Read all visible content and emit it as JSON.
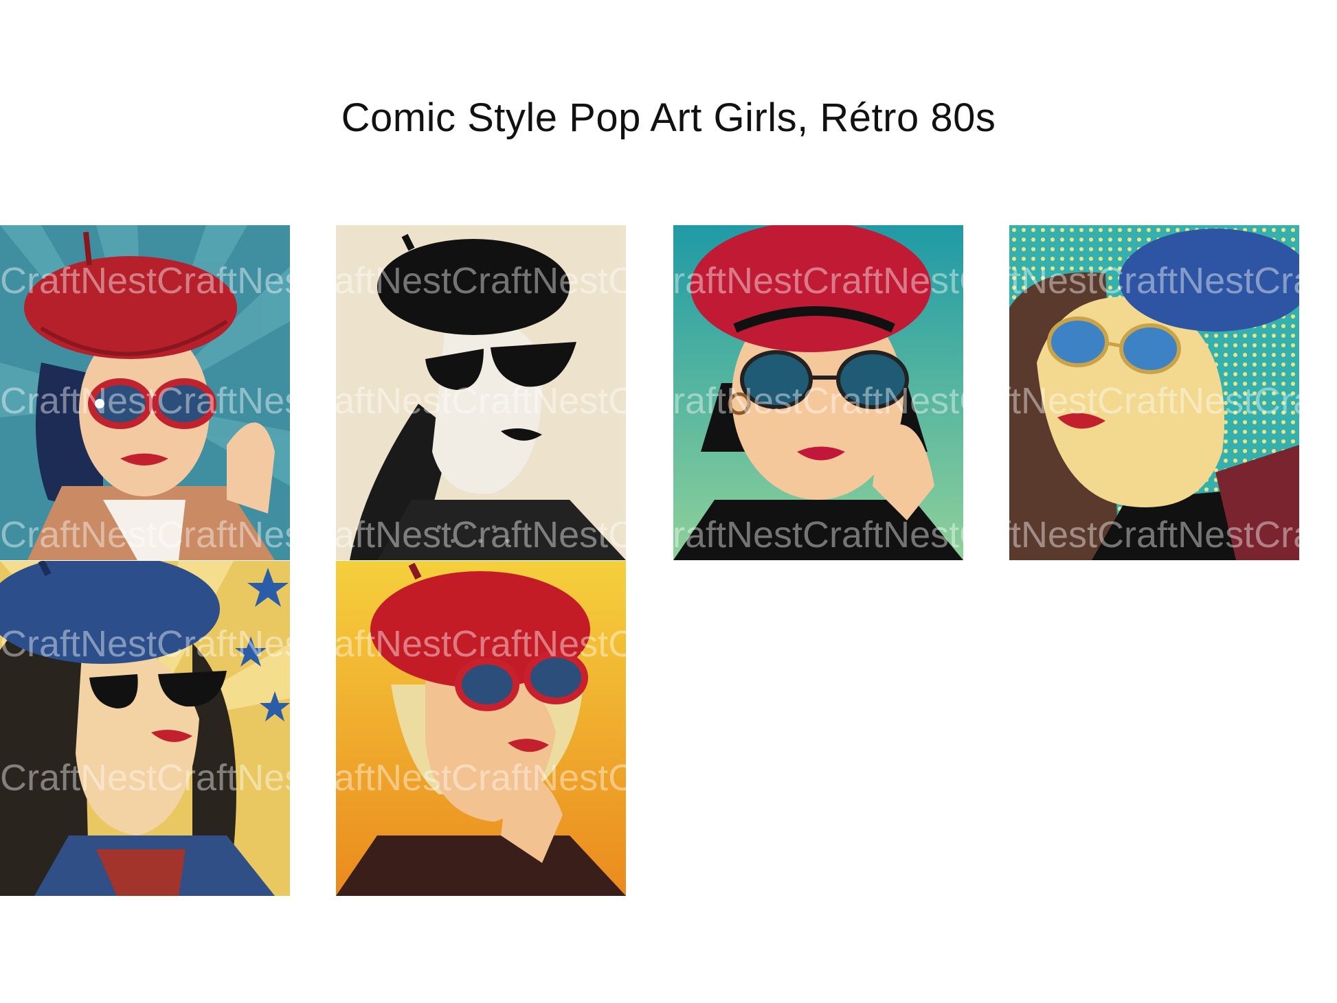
{
  "page": {
    "title": "Comic Style Pop Art Girls, Rétro 80s",
    "watermark": "CraftNestCraftNestCraftNestCraftNest"
  },
  "artworks": [
    {
      "name": "red-beret-red-sunglasses-sunburst",
      "beret": "#b5202b",
      "glasses": "#c0232e",
      "bg": "#3f8fa0",
      "hair": "#1c2c55"
    },
    {
      "name": "black-beret-black-sunglasses-monochrome",
      "beret": "#111111",
      "glasses": "#111111",
      "bg": "#ede3cc",
      "hair": "#222222"
    },
    {
      "name": "red-beret-round-sunglasses-teal",
      "beret": "#c01a35",
      "glasses": "#1a1a1a",
      "bg": "#2fa3a8",
      "hair": "#111111"
    },
    {
      "name": "blue-beret-aviators-polka-dot",
      "beret": "#2e55a3",
      "glasses": "#c9a34a",
      "bg": "#35b0ad",
      "hair": "#5a3a2c"
    },
    {
      "name": "blue-beret-black-sunglasses-stars",
      "beret": "#2c4f8c",
      "glasses": "#111111",
      "bg": "#e9c862",
      "hair": "#2a241e"
    },
    {
      "name": "red-beret-red-sunglasses-yellow",
      "beret": "#c41c27",
      "glasses": "#c8202c",
      "bg": "#f0b22a",
      "hair": "#ecdca0"
    }
  ]
}
